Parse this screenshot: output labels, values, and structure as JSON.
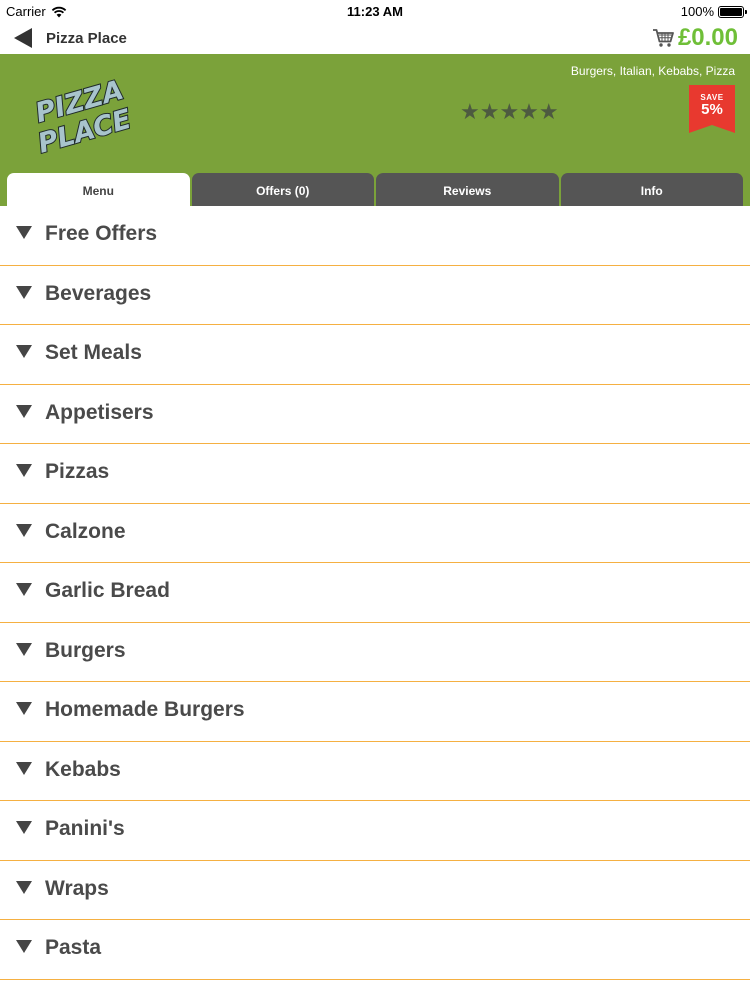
{
  "status_bar": {
    "carrier": "Carrier",
    "time": "11:23 AM",
    "battery": "100%"
  },
  "nav": {
    "title": "Pizza Place",
    "cart_total": "£0.00"
  },
  "restaurant": {
    "logo_text_line1": "PIZZA",
    "logo_text_line2": "PLACE",
    "cuisines": "Burgers, Italian, Kebabs, Pizza",
    "rating": 5,
    "stars": "★★★★★",
    "save_label": "SAVE",
    "save_value": "5%"
  },
  "tabs": [
    {
      "label": "Menu",
      "active": true
    },
    {
      "label": "Offers (0)",
      "active": false
    },
    {
      "label": "Reviews",
      "active": false
    },
    {
      "label": "Info",
      "active": false
    }
  ],
  "menu_categories": [
    "Free Offers",
    "Beverages",
    "Set Meals",
    "Appetisers",
    "Pizzas",
    "Calzone",
    "Garlic Bread",
    "Burgers",
    "Homemade Burgers",
    "Kebabs",
    "Panini's",
    "Wraps",
    "Pasta"
  ],
  "colors": {
    "banner": "#7ba23a",
    "accent_green": "#6fbf38",
    "divider": "#f5b042",
    "badge_red": "#e8392f",
    "tab_dark": "#555555"
  }
}
